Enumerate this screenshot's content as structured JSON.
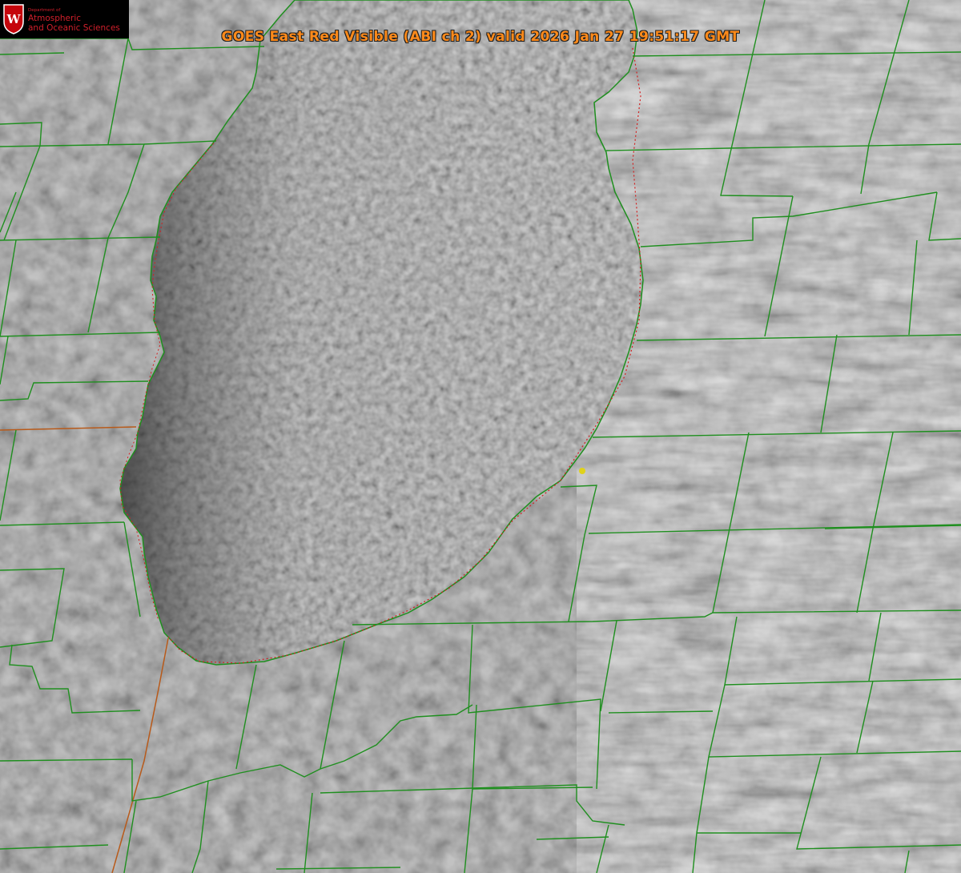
{
  "title": "GOES East Red Visible (ABI ch 2) valid 2026 Jan 27 19:51:17 GMT",
  "logo": {
    "department": "Department of",
    "line1": "Atmospheric",
    "line2": "and Oceanic Sciences",
    "crest_letter": "W",
    "brand_color": "#c5050c"
  },
  "map": {
    "imagery": "satellite-visible-grayscale",
    "county_border_color": "#1f8f1f",
    "state_border_color": "#b85a1a",
    "shoreline_color": "#1f8f1f",
    "lake_outline_color": "#d22020",
    "station_marker_color": "#e0d21a"
  }
}
